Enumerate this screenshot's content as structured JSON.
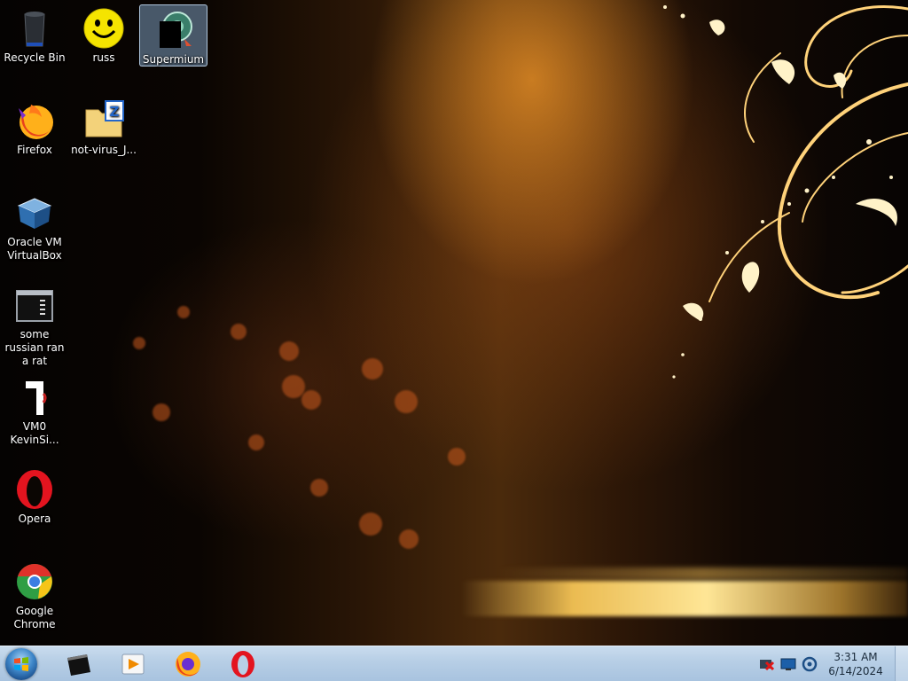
{
  "desktop": {
    "icons": [
      {
        "label": "Recycle Bin",
        "icon": "recycle-bin-icon"
      },
      {
        "label": "russ",
        "icon": "smiley-icon"
      },
      {
        "label": "Supermium",
        "icon": "supermium-icon"
      },
      {
        "label": "Firefox",
        "icon": "firefox-icon"
      },
      {
        "label": "not-virus_J...",
        "icon": "zip-folder-icon"
      },
      {
        "label": "Oracle VM VirtualBox",
        "icon": "virtualbox-icon"
      },
      {
        "label": "some russian ran a rat",
        "icon": "terminal-icon"
      },
      {
        "label": "VM0 KevinSi...",
        "icon": "shortcut-icon"
      },
      {
        "label": "Opera",
        "icon": "opera-icon"
      },
      {
        "label": "Google Chrome",
        "icon": "chrome-icon"
      }
    ]
  },
  "taskbar": {
    "start_icon": "windows-orb-icon",
    "pinned": [
      {
        "icon": "terminal-icon"
      },
      {
        "icon": "media-player-icon"
      },
      {
        "icon": "firefox-icon"
      },
      {
        "icon": "opera-icon"
      }
    ],
    "tray_icons": [
      "network-error-icon",
      "display-icon",
      "supermium-tray-icon"
    ],
    "clock": {
      "time": "3:31 AM",
      "date": "6/14/2024"
    }
  },
  "colors": {
    "taskbar": "#b8cfe6",
    "selection": "#96bee6",
    "wallpaper_gold": "#f0a030"
  }
}
